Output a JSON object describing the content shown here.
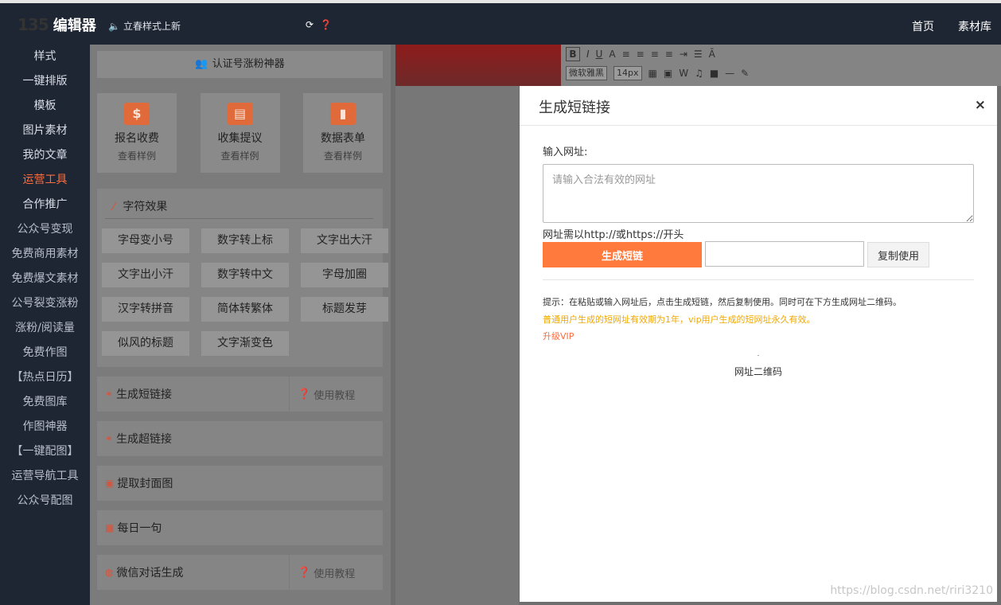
{
  "header": {
    "logo_mark": "135",
    "logo_text": "编辑器",
    "notice": "立春样式上新",
    "nav": [
      "首页",
      "素材库"
    ]
  },
  "sidebar": {
    "items": [
      {
        "label": "样式",
        "active": false
      },
      {
        "label": "一键排版",
        "active": false
      },
      {
        "label": "模板",
        "active": false
      },
      {
        "label": "图片素材",
        "active": false
      },
      {
        "label": "我的文章",
        "active": false
      },
      {
        "label": "运营工具",
        "active": true
      },
      {
        "label": "合作推广",
        "active": false
      },
      {
        "label": "公众号变现",
        "active": false
      },
      {
        "label": "免费商用素材",
        "active": false
      },
      {
        "label": "免费爆文素材",
        "active": false
      },
      {
        "label": "公号裂变涨粉",
        "active": false
      },
      {
        "label": "涨粉/阅读量",
        "active": false
      },
      {
        "label": "免费作图",
        "active": false
      },
      {
        "label": "【热点日历】",
        "active": false
      },
      {
        "label": "免费图库",
        "active": false
      },
      {
        "label": "作图神器",
        "active": false
      },
      {
        "label": "【一键配图】",
        "active": false
      },
      {
        "label": "运营导航工具",
        "active": false
      },
      {
        "label": "公众号配图",
        "active": false
      }
    ]
  },
  "tools": {
    "fans_button": "认证号涨粉神器",
    "tiles": [
      {
        "title": "报名收费",
        "sub": "查看样例",
        "icon": "money-icon"
      },
      {
        "title": "收集提议",
        "sub": "查看样例",
        "icon": "book-icon"
      },
      {
        "title": "数据表单",
        "sub": "查看样例",
        "icon": "bar-chart-icon"
      }
    ],
    "effects_title": "字符效果",
    "effects": [
      "字母变小号",
      "数字转上标",
      "文字出大汗",
      "文字出小汗",
      "数字转中文",
      "字母加圈",
      "汉字转拼音",
      "简体转繁体",
      "标题发芽",
      "似风的标题",
      "文字渐变色"
    ],
    "rows": [
      {
        "label": "生成短链接",
        "tutorial": "使用教程",
        "icon": "link-icon"
      },
      {
        "label": "生成超链接",
        "tutorial": "",
        "icon": "link-icon"
      },
      {
        "label": "提取封面图",
        "tutorial": "",
        "icon": "image-icon"
      },
      {
        "label": "每日一句",
        "tutorial": "",
        "icon": "calendar-icon"
      },
      {
        "label": "微信对话生成",
        "tutorial": "使用教程",
        "icon": "wechat-icon"
      }
    ]
  },
  "editor": {
    "font_family": "微软雅黑",
    "font_size": "14px"
  },
  "modal": {
    "title": "生成短链接",
    "close": "×",
    "url_label": "输入网址:",
    "url_placeholder": "请输入合法有效的网址",
    "url_hint": "网址需以http://或https://开头",
    "generate_label": "生成短链",
    "copy_label": "复制使用",
    "tip": "提示：在粘贴或输入网址后，点击生成短链，然后复制使用。同时可在下方生成网址二维码。",
    "tip_warn": "普通用户生成的短网址有效期为1年，vip用户生成的短网址永久有效。",
    "upgrade": "升级VIP",
    "qr_label": "网址二维码"
  },
  "watermark": "https://blog.csdn.net/riri3210",
  "colors": {
    "accent": "#ff7a3c",
    "warn": "#f0a800",
    "sidebar_bg": "#1f2633"
  }
}
